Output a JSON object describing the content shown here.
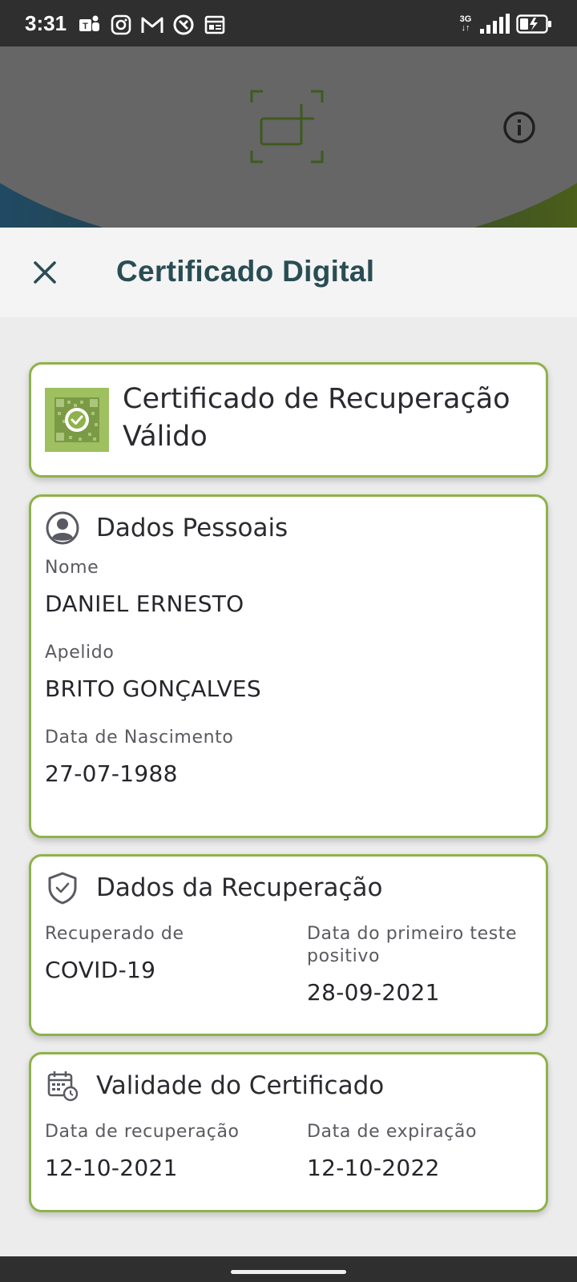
{
  "status_bar": {
    "time": "3:31",
    "network": "3G",
    "icons": [
      "teams-icon",
      "instagram-icon",
      "gmail-icon",
      "browser-icon",
      "calendar-icon",
      "signal-icon",
      "battery-icon"
    ]
  },
  "colors": {
    "accent_green": "#8fb24a",
    "title_teal": "#2a4d54",
    "overlay_gray": "#666666"
  },
  "modal": {
    "title": "Certificado Digital"
  },
  "certificate": {
    "status": "Certificado de Recuperação Válido"
  },
  "personal": {
    "title": "Dados Pessoais",
    "name_label": "Nome",
    "name_value": "DANIEL ERNESTO",
    "surname_label": "Apelido",
    "surname_value": "BRITO GONÇALVES",
    "dob_label": "Data de Nascimento",
    "dob_value": "27-07-1988"
  },
  "recovery": {
    "title": "Dados da Recuperação",
    "recovered_from_label": "Recuperado de",
    "recovered_from_value": "COVID-19",
    "first_positive_label": "Data do primeiro teste positivo",
    "first_positive_value": "28-09-2021"
  },
  "validity": {
    "title": "Validade do Certificado",
    "recovery_date_label": "Data de recuperação",
    "recovery_date_value": "12-10-2021",
    "expiry_label": "Data de expiração",
    "expiry_value": "12-10-2022"
  }
}
